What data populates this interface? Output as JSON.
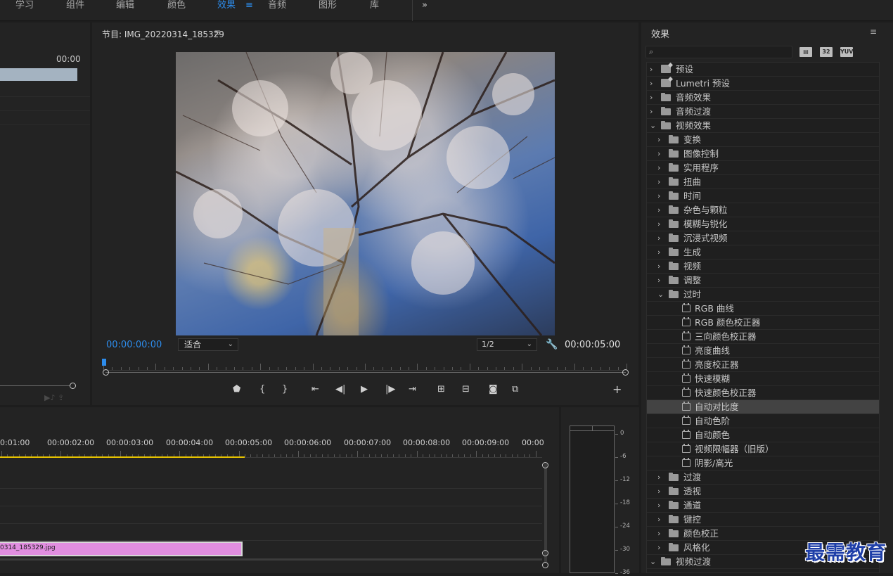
{
  "workspace_tabs": [
    "学习",
    "组件",
    "编辑",
    "颜色",
    "效果",
    "音频",
    "图形",
    "库"
  ],
  "workspace_active": "效果",
  "workspace_menu_icon": "hamburger-icon",
  "source_panel": {
    "timecode": "00:00"
  },
  "program": {
    "title": "节目: IMG_20220314_185329",
    "timecode": "00:00:00:00",
    "fit": "适合",
    "resolution": "1/2",
    "duration": "00:00:05:00"
  },
  "effects": {
    "title": "效果",
    "search_placeholder": "",
    "filter_buttons": [
      "32",
      "YUV"
    ],
    "tree": [
      {
        "label": "预设",
        "level": 0,
        "kind": "preset",
        "open": false
      },
      {
        "label": "Lumetri 预设",
        "level": 0,
        "kind": "preset",
        "open": false
      },
      {
        "label": "音频效果",
        "level": 0,
        "kind": "folder",
        "open": false
      },
      {
        "label": "音频过渡",
        "level": 0,
        "kind": "folder",
        "open": false
      },
      {
        "label": "视频效果",
        "level": 0,
        "kind": "folder",
        "open": true
      },
      {
        "label": "变换",
        "level": 1,
        "kind": "folder",
        "open": false
      },
      {
        "label": "图像控制",
        "level": 1,
        "kind": "folder",
        "open": false
      },
      {
        "label": "实用程序",
        "level": 1,
        "kind": "folder",
        "open": false
      },
      {
        "label": "扭曲",
        "level": 1,
        "kind": "folder",
        "open": false
      },
      {
        "label": "时间",
        "level": 1,
        "kind": "folder",
        "open": false
      },
      {
        "label": "杂色与颗粒",
        "level": 1,
        "kind": "folder",
        "open": false
      },
      {
        "label": "模糊与锐化",
        "level": 1,
        "kind": "folder",
        "open": false
      },
      {
        "label": "沉浸式视频",
        "level": 1,
        "kind": "folder",
        "open": false
      },
      {
        "label": "生成",
        "level": 1,
        "kind": "folder",
        "open": false
      },
      {
        "label": "视频",
        "level": 1,
        "kind": "folder",
        "open": false
      },
      {
        "label": "调整",
        "level": 1,
        "kind": "folder",
        "open": false
      },
      {
        "label": "过时",
        "level": 1,
        "kind": "folder",
        "open": true
      },
      {
        "label": "RGB 曲线",
        "level": 2,
        "kind": "effect"
      },
      {
        "label": "RGB 颜色校正器",
        "level": 2,
        "kind": "effect"
      },
      {
        "label": "三向颜色校正器",
        "level": 2,
        "kind": "effect"
      },
      {
        "label": "亮度曲线",
        "level": 2,
        "kind": "effect"
      },
      {
        "label": "亮度校正器",
        "level": 2,
        "kind": "effect"
      },
      {
        "label": "快速模糊",
        "level": 2,
        "kind": "effect"
      },
      {
        "label": "快速颜色校正器",
        "level": 2,
        "kind": "effect"
      },
      {
        "label": "自动对比度",
        "level": 2,
        "kind": "effect",
        "selected": true
      },
      {
        "label": "自动色阶",
        "level": 2,
        "kind": "effect"
      },
      {
        "label": "自动颜色",
        "level": 2,
        "kind": "effect"
      },
      {
        "label": "视频限幅器（旧版）",
        "level": 2,
        "kind": "effect"
      },
      {
        "label": "阴影/高光",
        "level": 2,
        "kind": "effect"
      },
      {
        "label": "过渡",
        "level": 1,
        "kind": "folder",
        "open": false
      },
      {
        "label": "透视",
        "level": 1,
        "kind": "folder",
        "open": false
      },
      {
        "label": "通道",
        "level": 1,
        "kind": "folder",
        "open": false
      },
      {
        "label": "键控",
        "level": 1,
        "kind": "folder",
        "open": false
      },
      {
        "label": "颜色校正",
        "level": 1,
        "kind": "folder",
        "open": false
      },
      {
        "label": "风格化",
        "level": 1,
        "kind": "folder",
        "open": false
      },
      {
        "label": "视频过渡",
        "level": 0,
        "kind": "folder",
        "open": true
      }
    ]
  },
  "timeline": {
    "ruler_labels": [
      "0:01:00",
      "00:00:02:00",
      "00:00:03:00",
      "00:00:04:00",
      "00:00:05:00",
      "00:00:06:00",
      "00:00:07:00",
      "00:00:08:00",
      "00:00:09:00",
      "00:00"
    ],
    "clip_label": "0314_185329.jpg"
  },
  "meter": {
    "labels": [
      "0",
      "-6",
      "-12",
      "-18",
      "-24",
      "-30",
      "-36"
    ]
  },
  "watermark": "最需教育",
  "colors": {
    "accent": "#2d8ceb",
    "clip": "#e18ee0",
    "work_area": "#e6c200"
  }
}
